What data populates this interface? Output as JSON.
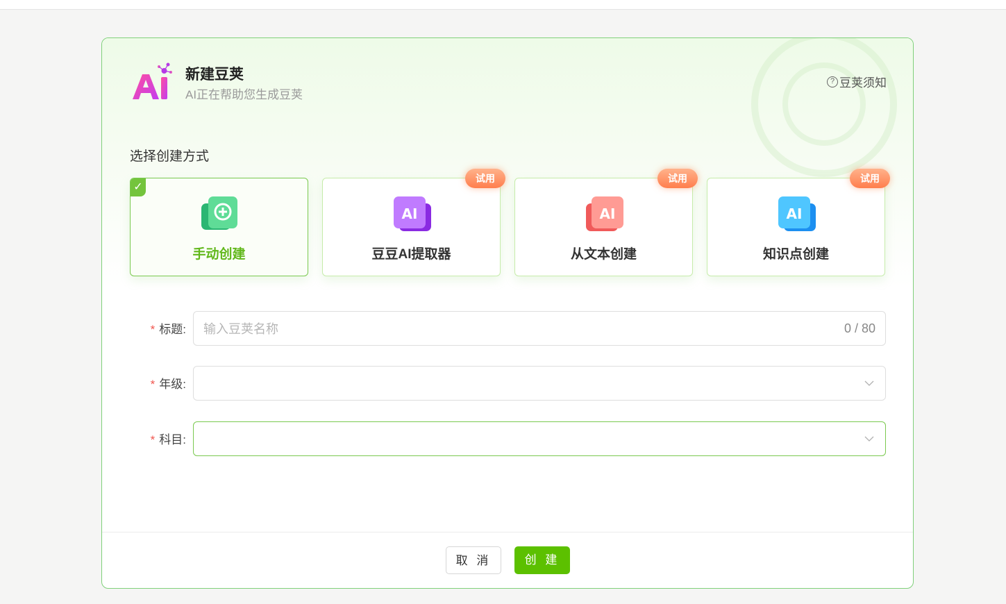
{
  "dialog": {
    "title": "新建豆荚",
    "subtitle": "AI正在帮助您生成豆荚",
    "notice_label": "豆荚须知",
    "section_label": "选择创建方式"
  },
  "cards": [
    {
      "label": "手动创建",
      "icon": "add-plus-icon",
      "selected": true,
      "badge": ""
    },
    {
      "label": "豆豆AI提取器",
      "icon": "ai-purple-icon",
      "selected": false,
      "badge": "试用"
    },
    {
      "label": "从文本创建",
      "icon": "ai-red-icon",
      "selected": false,
      "badge": "试用"
    },
    {
      "label": "知识点创建",
      "icon": "ai-blue-icon",
      "selected": false,
      "badge": "试用"
    }
  ],
  "form": {
    "required_mark": "*",
    "title": {
      "label": "标题:",
      "placeholder": "输入豆荚名称",
      "value": "",
      "counter": "0 / 80"
    },
    "grade": {
      "label": "年级:",
      "value": ""
    },
    "subject": {
      "label": "科目:",
      "value": ""
    }
  },
  "footer": {
    "cancel_label": "取 消",
    "create_label": "创 建"
  },
  "colors": {
    "accent": "#5cc000",
    "badge": "#ff8a5c",
    "required": "#f0564f"
  }
}
